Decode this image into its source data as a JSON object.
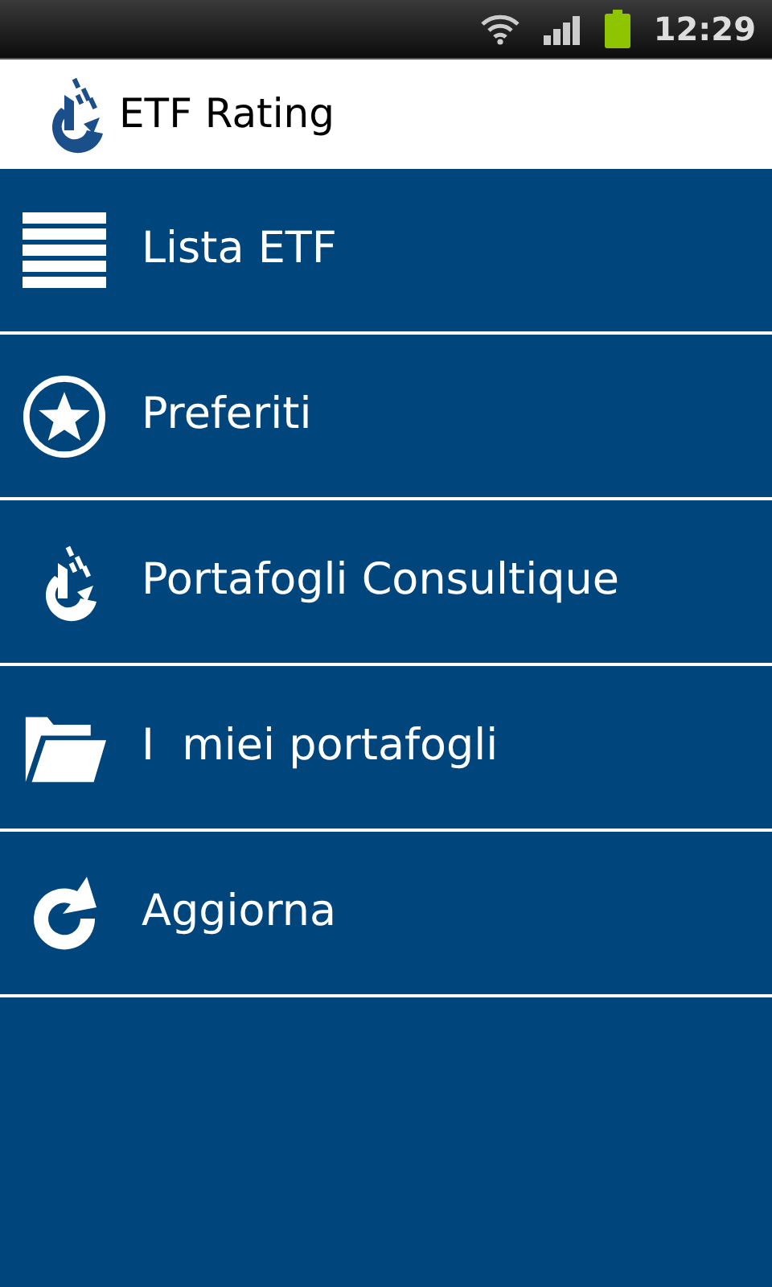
{
  "status_bar": {
    "time": "12:29"
  },
  "app_bar": {
    "title": "ETF Rating"
  },
  "menu": [
    {
      "label": "Lista ETF",
      "kind": "list"
    },
    {
      "label": "Preferiti",
      "kind": "star"
    },
    {
      "label": "Portafogli Consultique",
      "kind": "logo"
    },
    {
      "label": "I  miei portafogli",
      "kind": "folder"
    },
    {
      "label": "Aggiorna",
      "kind": "refresh"
    }
  ]
}
